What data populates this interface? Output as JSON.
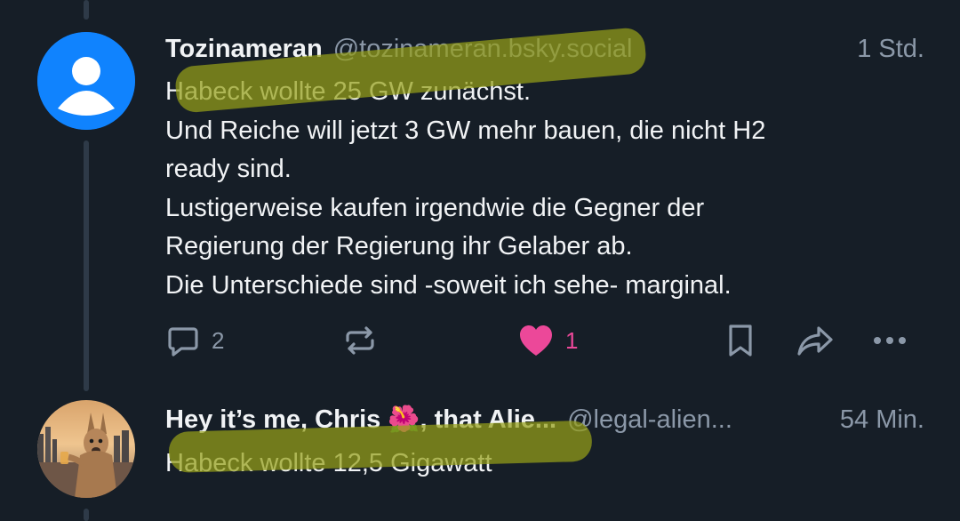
{
  "colors": {
    "background": "#161e27",
    "text": "#f1f3f5",
    "muted": "#8b98a8",
    "like": "#ec4899",
    "highlight_marker": "#969a19",
    "default_avatar": "#1083fe"
  },
  "posts": [
    {
      "author_name": "Tozinameran",
      "handle": "@tozinameran.bsky.social",
      "time": "1 Std.",
      "avatar_icon": "default-user-avatar-icon",
      "lines": [
        "Habeck wollte 25 GW zunächst.",
        "Und Reiche will jetzt 3 GW mehr bauen, die nicht H2",
        "ready sind.",
        "Lustigerweise kaufen irgendwie die Gegner der",
        "Regierung der Regierung ihr Gelaber ab.",
        "Die Unterschiede sind -soweit ich sehe- marginal."
      ],
      "actions": {
        "reply_count": "2",
        "repost_count": "",
        "like_count": "1",
        "liked": true,
        "icons": [
          "reply-icon",
          "repost-icon",
          "heart-icon",
          "bookmark-icon",
          "share-icon",
          "more-icon"
        ]
      }
    },
    {
      "author_name": "Hey it’s me, Chris 🌺, that Alie...",
      "handle": "@legal-alien...",
      "time": "54 Min.",
      "avatar_icon": "kangaroo-photo-avatar",
      "lines": [
        "Habeck wollte 12,5 Gigawatt"
      ]
    }
  ]
}
